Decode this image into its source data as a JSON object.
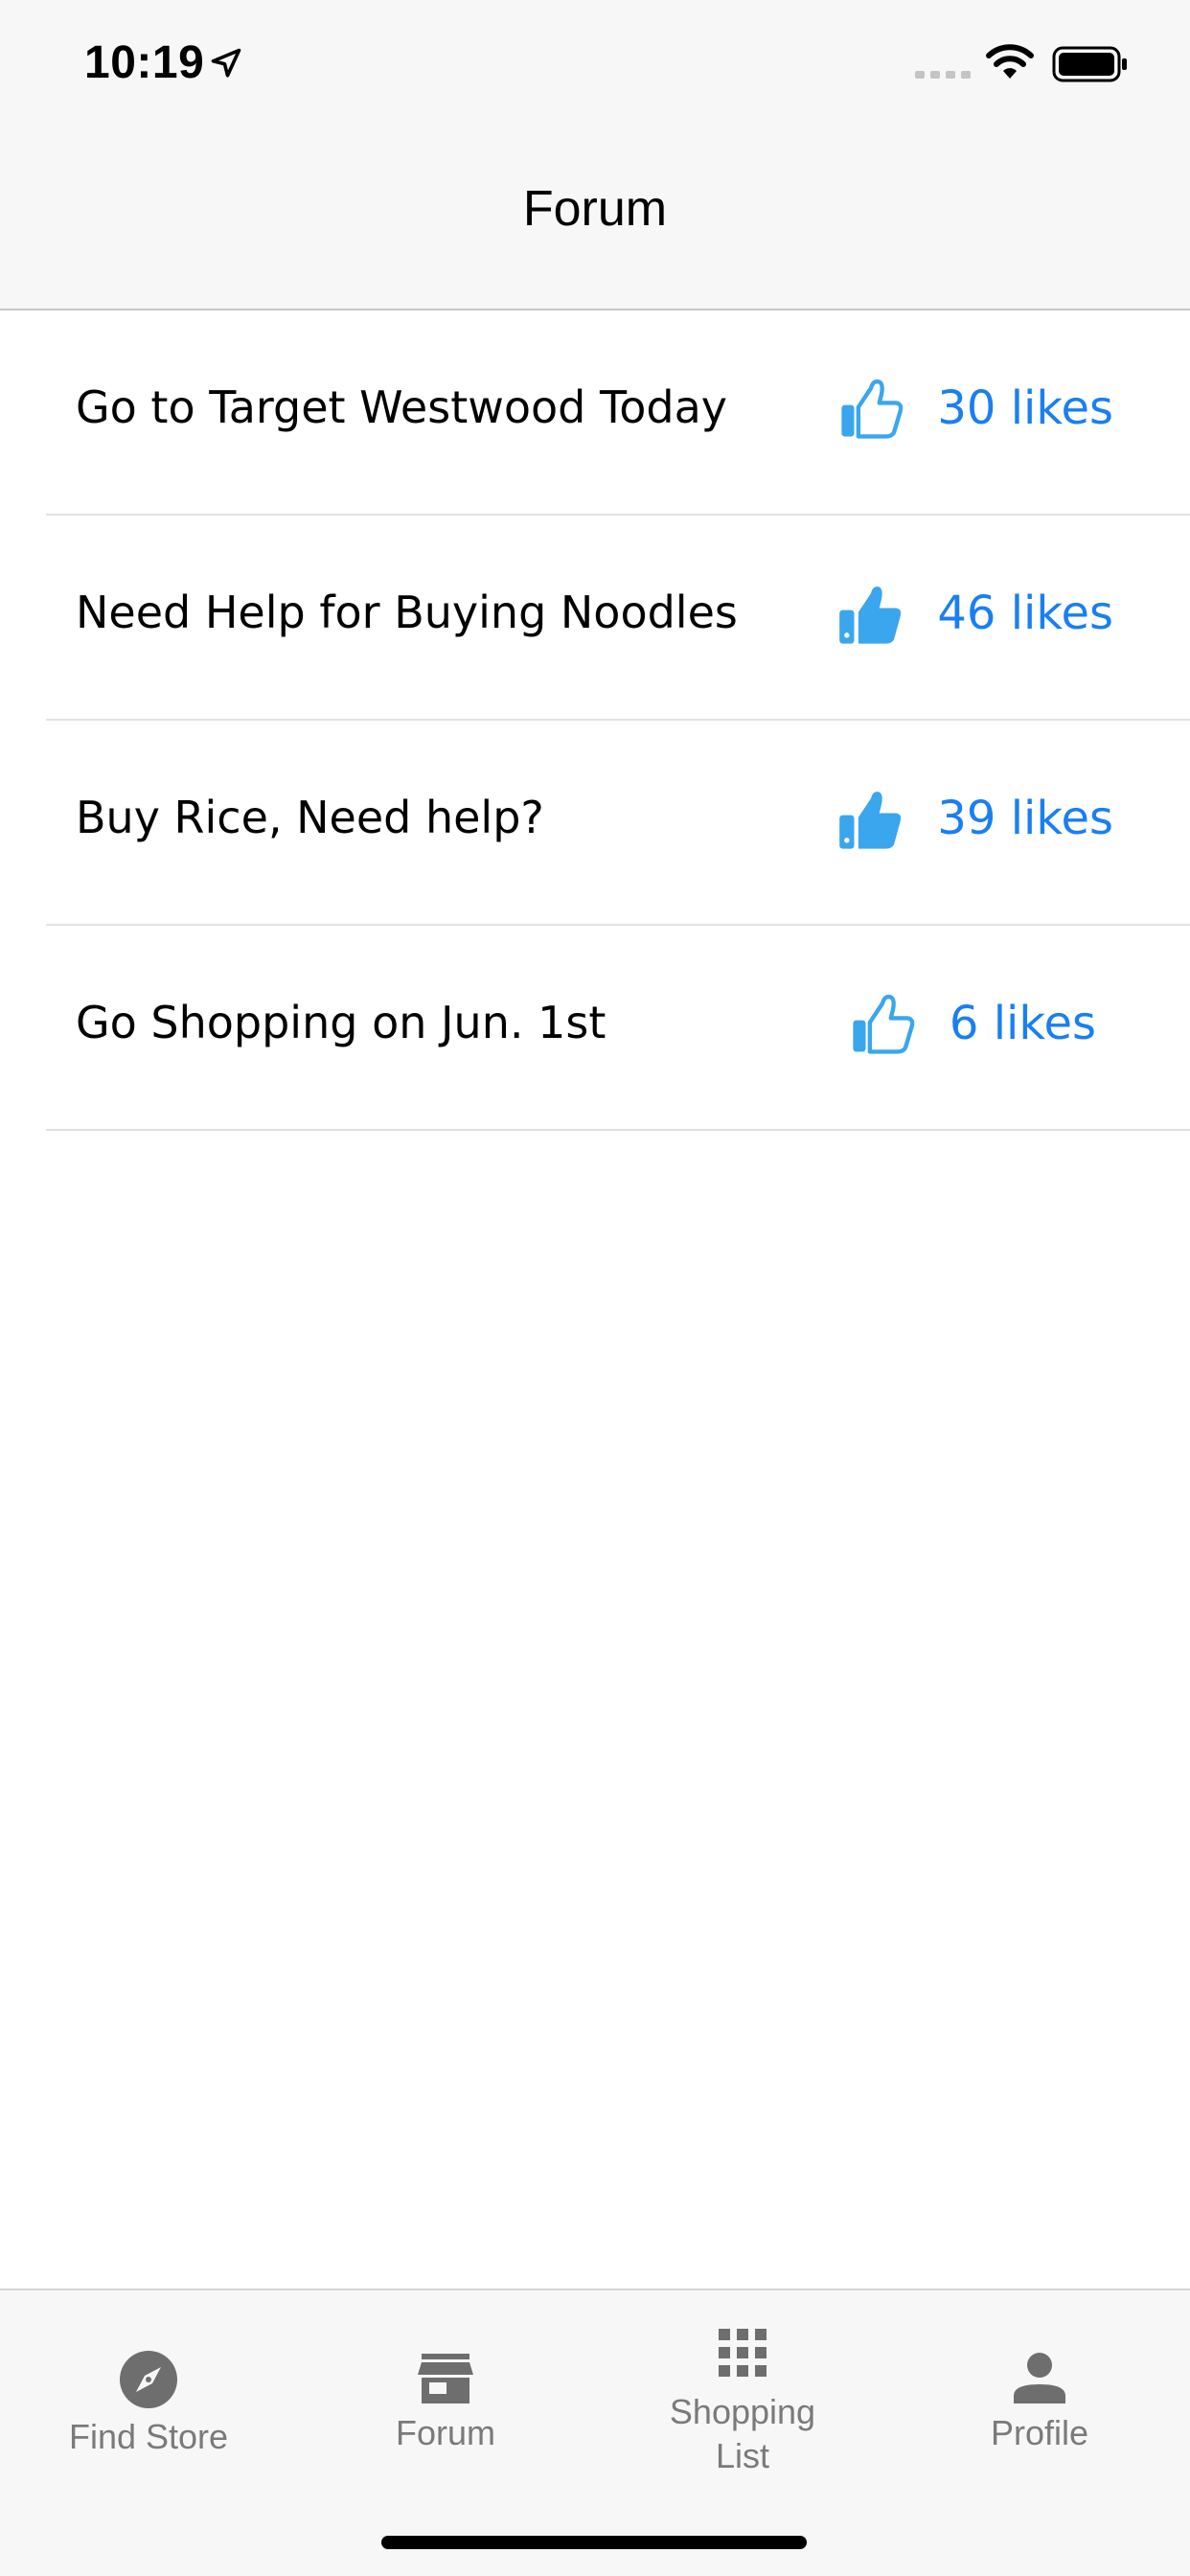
{
  "status_bar": {
    "time": "10:19",
    "icons": [
      "location-arrow-icon",
      "cellular-signal-icon",
      "wifi-icon",
      "battery-icon"
    ]
  },
  "nav": {
    "title": "Forum"
  },
  "posts": [
    {
      "title": "Go to Target Westwood Today",
      "likes": "30 likes",
      "liked": false
    },
    {
      "title": "Need Help for Buying Noodles",
      "likes": "46 likes",
      "liked": true
    },
    {
      "title": "Buy Rice, Need help?",
      "likes": "39 likes",
      "liked": true
    },
    {
      "title": "Go Shopping on Jun. 1st",
      "likes": "6 likes",
      "liked": false
    }
  ],
  "tabs": [
    {
      "label": "Find Store",
      "icon": "compass-icon"
    },
    {
      "label": "Forum",
      "icon": "store-icon"
    },
    {
      "label": "Shopping\nList",
      "icon": "grid-icon"
    },
    {
      "label": "Profile",
      "icon": "person-icon"
    }
  ],
  "colors": {
    "accent": "#1a7ff0",
    "thumb": "#3aa6ee",
    "tab_inactive": "#7a7a7a",
    "bar_background": "#f7f7f7"
  }
}
